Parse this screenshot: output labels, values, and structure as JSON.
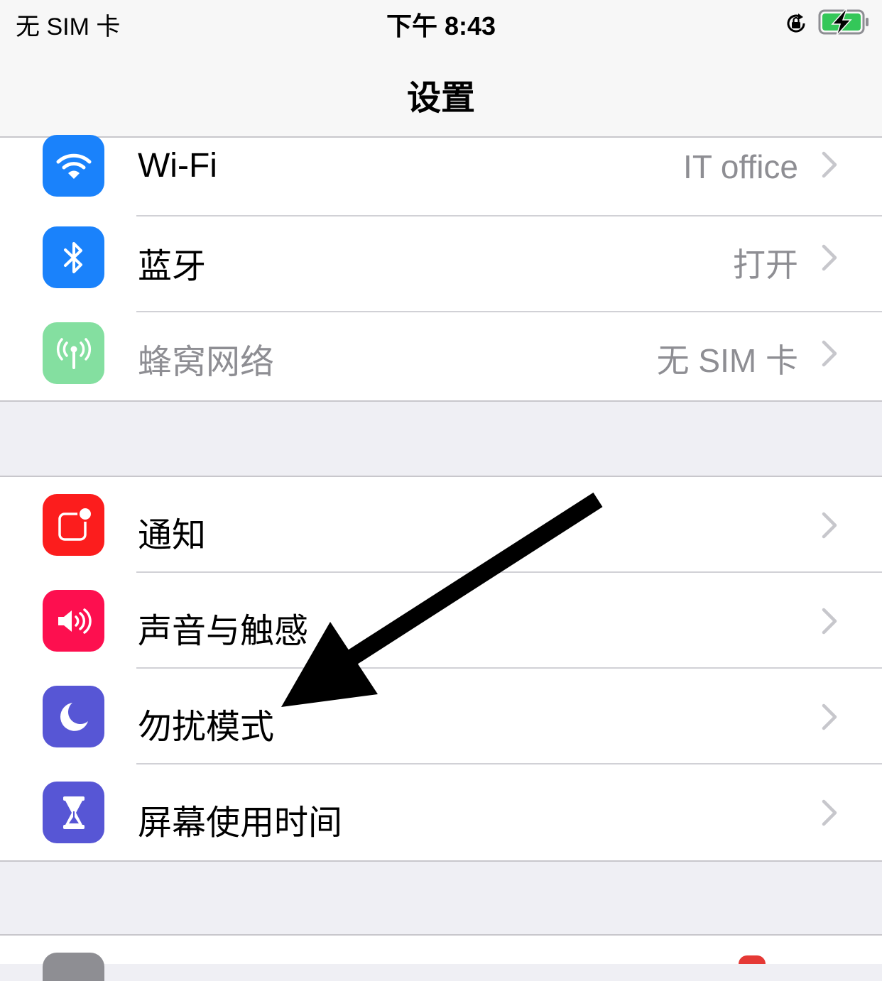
{
  "status_bar": {
    "carrier": "无 SIM 卡",
    "time": "下午 8:43",
    "icons": [
      "rotation-lock-icon",
      "battery-charging-icon"
    ],
    "battery_color": "#34c759"
  },
  "nav": {
    "title": "设置"
  },
  "groups": [
    {
      "rows": [
        {
          "label": "Wi-Fi",
          "value": "IT office",
          "icon": "wifi-icon",
          "icon_color": "#1a82fb",
          "disabled": false
        },
        {
          "label": "蓝牙",
          "value": "打开",
          "icon": "bluetooth-icon",
          "icon_color": "#1a82fb",
          "disabled": false
        },
        {
          "label": "蜂窝网络",
          "value": "无 SIM 卡",
          "icon": "cellular-antenna-icon",
          "icon_color": "#84dfa0",
          "disabled": true
        }
      ]
    },
    {
      "rows": [
        {
          "label": "通知",
          "value": "",
          "icon": "notifications-icon",
          "icon_color": "#fc1d1d"
        },
        {
          "label": "声音与触感",
          "value": "",
          "icon": "speaker-icon",
          "icon_color": "#fd0f4f"
        },
        {
          "label": "勿扰模式",
          "value": "",
          "icon": "moon-icon",
          "icon_color": "#5756d5"
        },
        {
          "label": "屏幕使用时间",
          "value": "",
          "icon": "hourglass-icon",
          "icon_color": "#5756d5"
        }
      ]
    }
  ],
  "annotation": {
    "type": "arrow",
    "points_to": "勿扰模式",
    "color": "#000000"
  }
}
